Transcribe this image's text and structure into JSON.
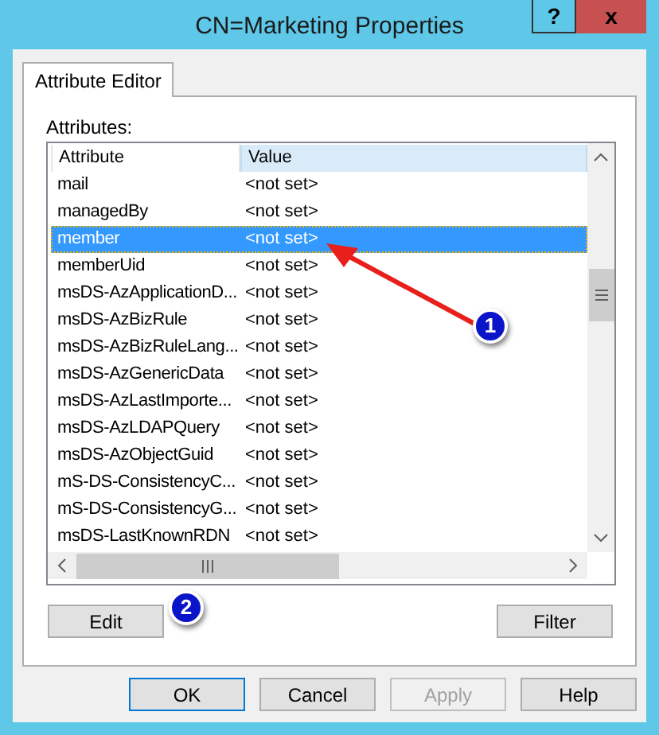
{
  "window": {
    "title": "CN=Marketing Properties",
    "help_button": "?",
    "close_button": "x"
  },
  "tabs": [
    {
      "label": "Attribute Editor",
      "selected": true
    }
  ],
  "attributes_label": "Attributes:",
  "table": {
    "columns": [
      {
        "label": "Attribute",
        "selected": false
      },
      {
        "label": "Value",
        "selected": true
      }
    ],
    "rows": [
      {
        "attribute": "mail",
        "value": "<not set>",
        "selected": false
      },
      {
        "attribute": "managedBy",
        "value": "<not set>",
        "selected": false
      },
      {
        "attribute": "member",
        "value": "<not set>",
        "selected": true
      },
      {
        "attribute": "memberUid",
        "value": "<not set>",
        "selected": false
      },
      {
        "attribute": "msDS-AzApplicationD...",
        "value": "<not set>",
        "selected": false
      },
      {
        "attribute": "msDS-AzBizRule",
        "value": "<not set>",
        "selected": false
      },
      {
        "attribute": "msDS-AzBizRuleLang...",
        "value": "<not set>",
        "selected": false
      },
      {
        "attribute": "msDS-AzGenericData",
        "value": "<not set>",
        "selected": false
      },
      {
        "attribute": "msDS-AzLastImporte...",
        "value": "<not set>",
        "selected": false
      },
      {
        "attribute": "msDS-AzLDAPQuery",
        "value": "<not set>",
        "selected": false
      },
      {
        "attribute": "msDS-AzObjectGuid",
        "value": "<not set>",
        "selected": false
      },
      {
        "attribute": "mS-DS-ConsistencyC...",
        "value": "<not set>",
        "selected": false
      },
      {
        "attribute": "mS-DS-ConsistencyG...",
        "value": "<not set>",
        "selected": false
      },
      {
        "attribute": "msDS-LastKnownRDN",
        "value": "<not set>",
        "selected": false
      }
    ]
  },
  "panel_buttons": [
    "Edit",
    "Filter"
  ],
  "buttons": [
    {
      "label": "OK",
      "disabled": false
    },
    {
      "label": "Cancel",
      "disabled": false
    },
    {
      "label": "Apply",
      "disabled": true
    },
    {
      "label": "Help",
      "disabled": false
    }
  ],
  "annotations": [
    {
      "label": "1"
    },
    {
      "label": "2"
    }
  ]
}
